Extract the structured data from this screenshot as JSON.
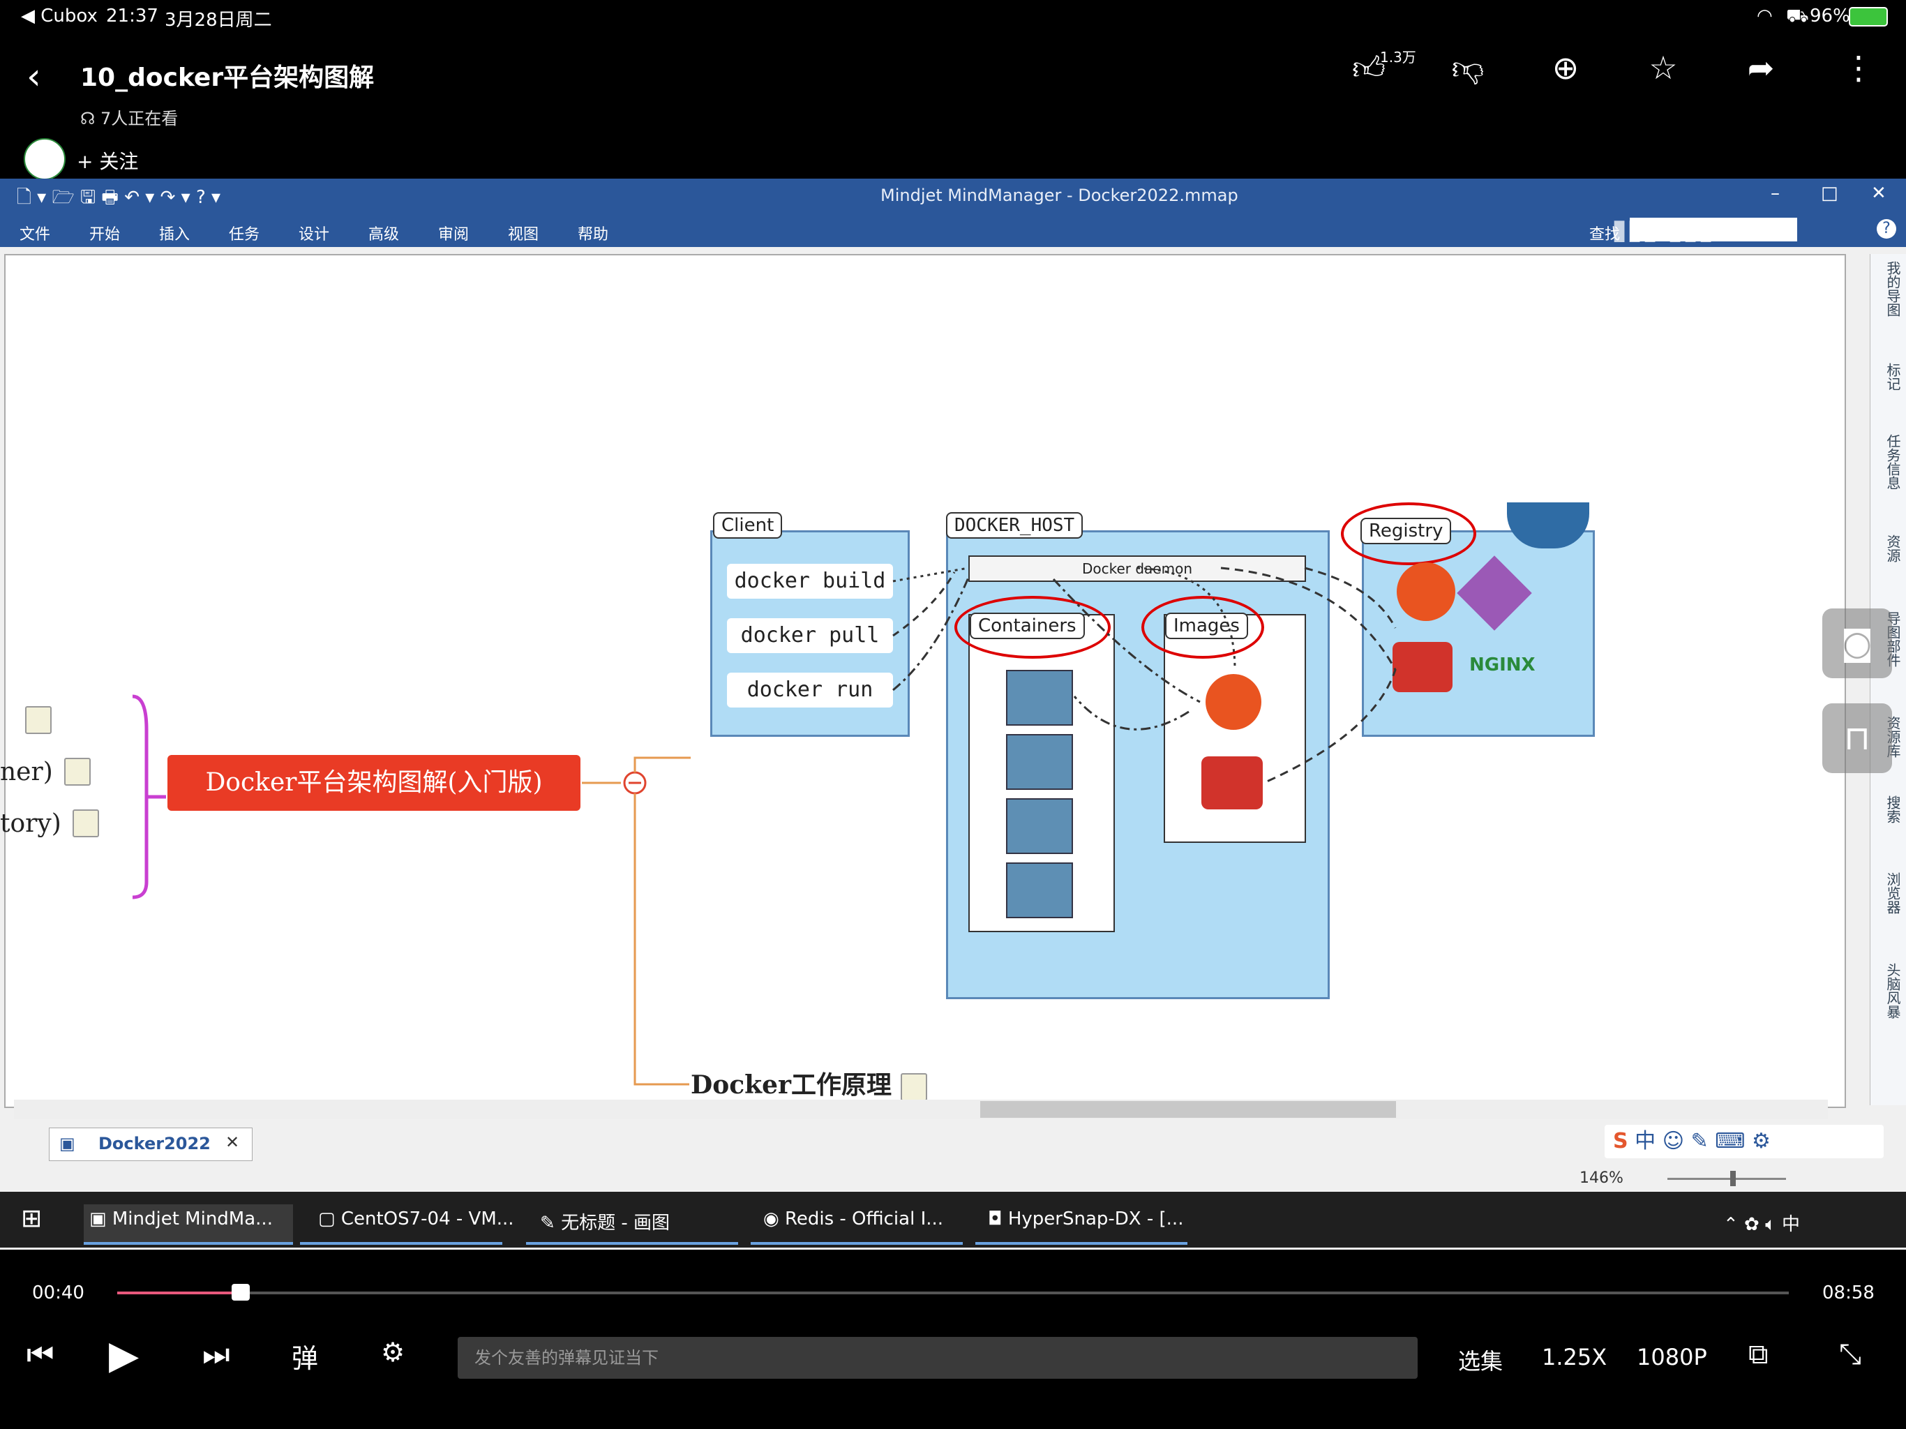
{
  "status_bar": {
    "back_app": "◀ Cubox",
    "time": "21:37",
    "date": "3月28日周二",
    "battery": "96%"
  },
  "header": {
    "title": "10_docker平台架构图解",
    "watching": "7人正在看",
    "follow": "关注",
    "like_count": "1.3万",
    "icons": [
      "like-icon",
      "dislike-icon",
      "coin-icon",
      "favorite-icon",
      "share-icon",
      "more-icon"
    ]
  },
  "mindmanager": {
    "window_title": "Mindjet MindManager - Docker2022.mmap",
    "menu": [
      "文件",
      "开始",
      "插入",
      "任务",
      "设计",
      "高级",
      "审阅",
      "视图",
      "帮助"
    ],
    "search_label": "查找",
    "right_panel": [
      "我的导图",
      "标记",
      "任务信息",
      "资源",
      "导图部件",
      "资源库",
      "搜索",
      "浏览器",
      "头脑风暴"
    ],
    "doc_tab": "Docker2022",
    "zoom": "146%"
  },
  "mindmap": {
    "central_topic": "Docker平台架构图解(入门版)",
    "left_partials": [
      "ner)",
      "tory)"
    ],
    "child_topic": "Docker工作原理"
  },
  "diagram": {
    "client_label": "Client",
    "commands": [
      "docker build",
      "docker pull",
      "docker run"
    ],
    "host_label": "DOCKER_HOST",
    "daemon_label": "Docker daemon",
    "containers_label": "Containers",
    "images_label": "Images",
    "registry_label": "Registry",
    "nginx_label": "NGINX"
  },
  "taskbar": {
    "items": [
      "Mindjet MindMa...",
      "CentOS7-04 - VM...",
      "无标题 - 画图",
      "Redis - Official I...",
      "HyperSnap-DX - [..."
    ],
    "ime": "中"
  },
  "player": {
    "current_time": "00:40",
    "total_time": "08:58",
    "progress": 0.074,
    "danmaku_placeholder": "发个友善的弹幕见证当下",
    "episodes": "选集",
    "speed": "1.25X",
    "quality": "1080P"
  },
  "colors": {
    "accent_red": "#e93b25",
    "ribbon_blue": "#2b579a",
    "diagram_blue": "#b0dcf5",
    "progress_pink": "#e8587c"
  }
}
